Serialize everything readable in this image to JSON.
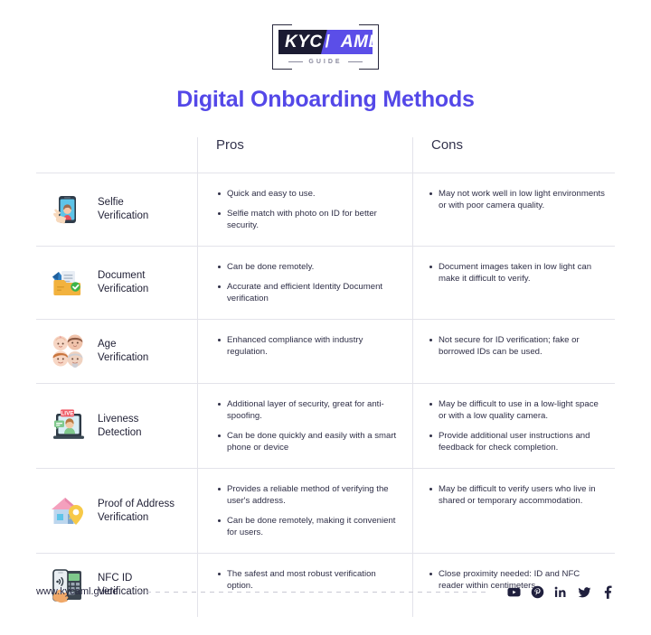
{
  "brand": {
    "logo_kyc": "KYC",
    "logo_slash": "/",
    "logo_aml": "AML",
    "logo_sub": "GUIDE",
    "accent_color": "#5448e8",
    "logo_dark": "#1b1b32"
  },
  "title": "Digital Onboarding Methods",
  "table": {
    "headers": {
      "method": "",
      "pros": "Pros",
      "cons": "Cons"
    },
    "rows": [
      {
        "icon": "selfie-phone-icon",
        "method": "Selfie\nVerification",
        "pros": [
          "Quick and easy to use.",
          "Selfie match with photo on ID for better security."
        ],
        "cons": [
          "May not work well in low light environments or with poor camera quality."
        ]
      },
      {
        "icon": "document-folder-check-icon",
        "method": "Document\nVerification",
        "pros": [
          "Can be done remotely.",
          "Accurate and efficient Identity Document verification"
        ],
        "cons": [
          "Document images taken in low light can make it difficult to verify."
        ]
      },
      {
        "icon": "age-faces-icon",
        "method": "Age\nVerification",
        "pros": [
          "Enhanced compliance with industry regulation."
        ],
        "cons": [
          "Not secure for ID verification; fake or borrowed IDs can be used."
        ]
      },
      {
        "icon": "liveness-live-video-icon",
        "method": "Liveness\nDetection",
        "pros": [
          "Additional layer of security, great for anti- spoofing.",
          "Can be done quickly and easily with a smart phone or device"
        ],
        "cons": [
          "May be difficult to use in a low-light space or with a low quality camera.",
          "Provide additional user instructions and feedback for check completion."
        ]
      },
      {
        "icon": "house-location-pin-icon",
        "method": "Proof of Address\nVerification",
        "pros": [
          "Provides a reliable method of verifying the user's address.",
          "Can be done remotely, making it convenient for users."
        ],
        "cons": [
          "May be difficult to verify users who live in shared or temporary accommodation."
        ]
      },
      {
        "icon": "nfc-phone-reader-icon",
        "method": "NFC ID\nVerification",
        "pros": [
          "The safest and most robust verification option."
        ],
        "cons": [
          "Close proximity needed: ID and NFC reader within centimeters."
        ]
      }
    ]
  },
  "footer": {
    "url": "www.kycaml.guide",
    "socials": [
      {
        "name": "youtube-icon"
      },
      {
        "name": "pinterest-icon"
      },
      {
        "name": "linkedin-icon"
      },
      {
        "name": "twitter-icon"
      },
      {
        "name": "facebook-icon"
      }
    ]
  }
}
